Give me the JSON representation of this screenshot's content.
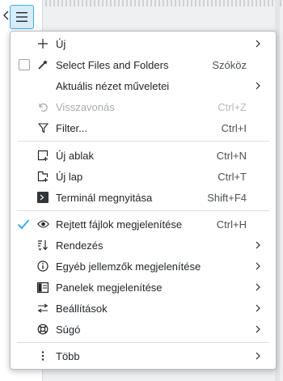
{
  "menu": {
    "group1": [
      {
        "label": "Új",
        "shortcut": "",
        "icon": "plus-icon",
        "submenu": true,
        "checkbox": null,
        "disabled": false
      },
      {
        "label": "Select Files and Folders",
        "shortcut": "Szóköz",
        "icon": "select-icon",
        "submenu": false,
        "checkbox": false,
        "disabled": false
      },
      {
        "label": "Aktuális nézet műveletei",
        "shortcut": "",
        "icon": "",
        "submenu": true,
        "checkbox": null,
        "disabled": false
      },
      {
        "label": "Visszavonás",
        "shortcut": "Ctrl+Z",
        "icon": "undo-icon",
        "submenu": false,
        "checkbox": null,
        "disabled": true
      },
      {
        "label": "Filter...",
        "shortcut": "Ctrl+I",
        "icon": "filter-icon",
        "submenu": false,
        "checkbox": null,
        "disabled": false
      }
    ],
    "group2": [
      {
        "label": "Új ablak",
        "shortcut": "Ctrl+N",
        "icon": "new-window-icon"
      },
      {
        "label": "Új lap",
        "shortcut": "Ctrl+T",
        "icon": "new-tab-icon"
      },
      {
        "label": "Terminál megnyitása",
        "shortcut": "Shift+F4",
        "icon": "terminal-icon"
      }
    ],
    "group3": [
      {
        "label": "Rejtett fájlok megjelenítése",
        "shortcut": "Ctrl+H",
        "icon": "eye-icon",
        "submenu": false,
        "checkbox": true
      },
      {
        "label": "Rendezés",
        "shortcut": "",
        "icon": "sort-icon",
        "submenu": true,
        "checkbox": null
      },
      {
        "label": "Egyéb jellemzők megjelenítése",
        "shortcut": "",
        "icon": "info-icon",
        "submenu": true,
        "checkbox": null
      },
      {
        "label": "Panelek megjelenítése",
        "shortcut": "",
        "icon": "panels-icon",
        "submenu": true,
        "checkbox": null
      },
      {
        "label": "Beállítások",
        "shortcut": "",
        "icon": "settings-icon",
        "submenu": true,
        "checkbox": null
      },
      {
        "label": "Súgó",
        "shortcut": "",
        "icon": "help-icon",
        "submenu": true,
        "checkbox": null
      }
    ],
    "more": {
      "label": "Több",
      "icon": "more-icon"
    }
  },
  "colors": {
    "accent": "#3daee9",
    "text": "#232629",
    "disabled": "#a7aaad"
  }
}
